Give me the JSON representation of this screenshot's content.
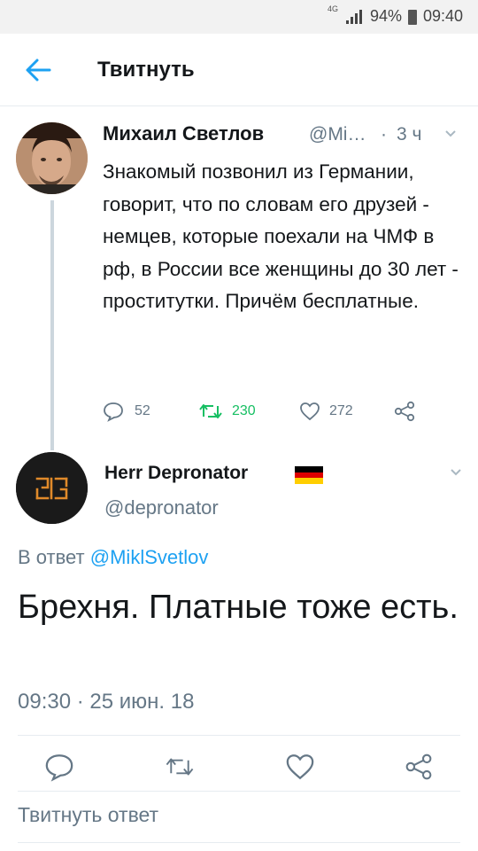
{
  "status_bar": {
    "network": "4G",
    "battery_percent": "94%",
    "time": "09:40"
  },
  "header": {
    "title": "Твитнуть"
  },
  "parent_tweet": {
    "author_name": "Михаил Светлов",
    "handle": "@Mi…",
    "separator": "·",
    "time": "3 ч",
    "text": "Знакомый позвонил из Германии, говорит, что по словам его друзей - немцев, которые поехали на ЧМФ в рф, в России все женщины до 30 лет - проститутки. Причём бесплатные.",
    "replies": "52",
    "retweets": "230",
    "likes": "272"
  },
  "reply_tweet": {
    "author_name": "Herr Depronator",
    "handle": "@depronator",
    "reply_prefix": "В ответ",
    "reply_target": "@MiklSvetlov",
    "text": "Брехня. Платные тоже есть.",
    "timestamp": "09:30 · 25 июн. 18"
  },
  "composer": {
    "placeholder": "Твитнуть ответ"
  },
  "colors": {
    "accent": "#1da1f2",
    "retweet": "#17bf63",
    "secondary_text": "#657786",
    "flag_black": "#000000",
    "flag_red": "#dd0000",
    "flag_gold": "#ffce00"
  },
  "icons": [
    "back-arrow-icon",
    "signal-icon",
    "battery-icon",
    "chevron-down-icon",
    "reply-icon",
    "retweet-icon",
    "like-icon",
    "share-icon",
    "germany-flag-icon",
    "rammstein-logo-icon"
  ]
}
